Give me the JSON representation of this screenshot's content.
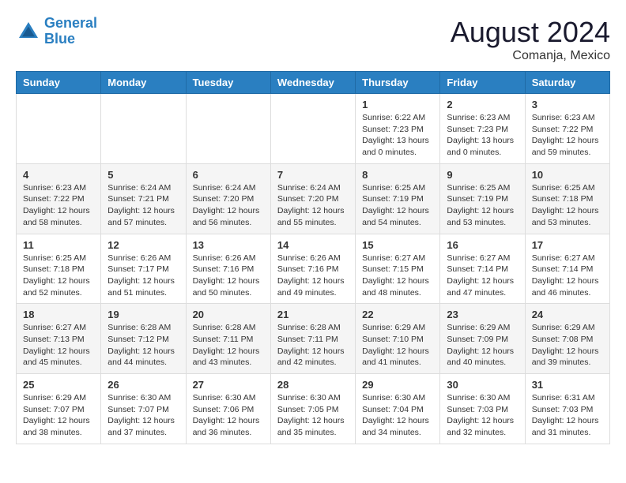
{
  "logo": {
    "line1": "General",
    "line2": "Blue"
  },
  "title": "August 2024",
  "location": "Comanja, Mexico",
  "days_of_week": [
    "Sunday",
    "Monday",
    "Tuesday",
    "Wednesday",
    "Thursday",
    "Friday",
    "Saturday"
  ],
  "weeks": [
    [
      {
        "day": "",
        "sunrise": "",
        "sunset": "",
        "daylight": ""
      },
      {
        "day": "",
        "sunrise": "",
        "sunset": "",
        "daylight": ""
      },
      {
        "day": "",
        "sunrise": "",
        "sunset": "",
        "daylight": ""
      },
      {
        "day": "",
        "sunrise": "",
        "sunset": "",
        "daylight": ""
      },
      {
        "day": "1",
        "sunrise": "Sunrise: 6:22 AM",
        "sunset": "Sunset: 7:23 PM",
        "daylight": "Daylight: 13 hours and 0 minutes."
      },
      {
        "day": "2",
        "sunrise": "Sunrise: 6:23 AM",
        "sunset": "Sunset: 7:23 PM",
        "daylight": "Daylight: 13 hours and 0 minutes."
      },
      {
        "day": "3",
        "sunrise": "Sunrise: 6:23 AM",
        "sunset": "Sunset: 7:22 PM",
        "daylight": "Daylight: 12 hours and 59 minutes."
      }
    ],
    [
      {
        "day": "4",
        "sunrise": "Sunrise: 6:23 AM",
        "sunset": "Sunset: 7:22 PM",
        "daylight": "Daylight: 12 hours and 58 minutes."
      },
      {
        "day": "5",
        "sunrise": "Sunrise: 6:24 AM",
        "sunset": "Sunset: 7:21 PM",
        "daylight": "Daylight: 12 hours and 57 minutes."
      },
      {
        "day": "6",
        "sunrise": "Sunrise: 6:24 AM",
        "sunset": "Sunset: 7:20 PM",
        "daylight": "Daylight: 12 hours and 56 minutes."
      },
      {
        "day": "7",
        "sunrise": "Sunrise: 6:24 AM",
        "sunset": "Sunset: 7:20 PM",
        "daylight": "Daylight: 12 hours and 55 minutes."
      },
      {
        "day": "8",
        "sunrise": "Sunrise: 6:25 AM",
        "sunset": "Sunset: 7:19 PM",
        "daylight": "Daylight: 12 hours and 54 minutes."
      },
      {
        "day": "9",
        "sunrise": "Sunrise: 6:25 AM",
        "sunset": "Sunset: 7:19 PM",
        "daylight": "Daylight: 12 hours and 53 minutes."
      },
      {
        "day": "10",
        "sunrise": "Sunrise: 6:25 AM",
        "sunset": "Sunset: 7:18 PM",
        "daylight": "Daylight: 12 hours and 53 minutes."
      }
    ],
    [
      {
        "day": "11",
        "sunrise": "Sunrise: 6:25 AM",
        "sunset": "Sunset: 7:18 PM",
        "daylight": "Daylight: 12 hours and 52 minutes."
      },
      {
        "day": "12",
        "sunrise": "Sunrise: 6:26 AM",
        "sunset": "Sunset: 7:17 PM",
        "daylight": "Daylight: 12 hours and 51 minutes."
      },
      {
        "day": "13",
        "sunrise": "Sunrise: 6:26 AM",
        "sunset": "Sunset: 7:16 PM",
        "daylight": "Daylight: 12 hours and 50 minutes."
      },
      {
        "day": "14",
        "sunrise": "Sunrise: 6:26 AM",
        "sunset": "Sunset: 7:16 PM",
        "daylight": "Daylight: 12 hours and 49 minutes."
      },
      {
        "day": "15",
        "sunrise": "Sunrise: 6:27 AM",
        "sunset": "Sunset: 7:15 PM",
        "daylight": "Daylight: 12 hours and 48 minutes."
      },
      {
        "day": "16",
        "sunrise": "Sunrise: 6:27 AM",
        "sunset": "Sunset: 7:14 PM",
        "daylight": "Daylight: 12 hours and 47 minutes."
      },
      {
        "day": "17",
        "sunrise": "Sunrise: 6:27 AM",
        "sunset": "Sunset: 7:14 PM",
        "daylight": "Daylight: 12 hours and 46 minutes."
      }
    ],
    [
      {
        "day": "18",
        "sunrise": "Sunrise: 6:27 AM",
        "sunset": "Sunset: 7:13 PM",
        "daylight": "Daylight: 12 hours and 45 minutes."
      },
      {
        "day": "19",
        "sunrise": "Sunrise: 6:28 AM",
        "sunset": "Sunset: 7:12 PM",
        "daylight": "Daylight: 12 hours and 44 minutes."
      },
      {
        "day": "20",
        "sunrise": "Sunrise: 6:28 AM",
        "sunset": "Sunset: 7:11 PM",
        "daylight": "Daylight: 12 hours and 43 minutes."
      },
      {
        "day": "21",
        "sunrise": "Sunrise: 6:28 AM",
        "sunset": "Sunset: 7:11 PM",
        "daylight": "Daylight: 12 hours and 42 minutes."
      },
      {
        "day": "22",
        "sunrise": "Sunrise: 6:29 AM",
        "sunset": "Sunset: 7:10 PM",
        "daylight": "Daylight: 12 hours and 41 minutes."
      },
      {
        "day": "23",
        "sunrise": "Sunrise: 6:29 AM",
        "sunset": "Sunset: 7:09 PM",
        "daylight": "Daylight: 12 hours and 40 minutes."
      },
      {
        "day": "24",
        "sunrise": "Sunrise: 6:29 AM",
        "sunset": "Sunset: 7:08 PM",
        "daylight": "Daylight: 12 hours and 39 minutes."
      }
    ],
    [
      {
        "day": "25",
        "sunrise": "Sunrise: 6:29 AM",
        "sunset": "Sunset: 7:07 PM",
        "daylight": "Daylight: 12 hours and 38 minutes."
      },
      {
        "day": "26",
        "sunrise": "Sunrise: 6:30 AM",
        "sunset": "Sunset: 7:07 PM",
        "daylight": "Daylight: 12 hours and 37 minutes."
      },
      {
        "day": "27",
        "sunrise": "Sunrise: 6:30 AM",
        "sunset": "Sunset: 7:06 PM",
        "daylight": "Daylight: 12 hours and 36 minutes."
      },
      {
        "day": "28",
        "sunrise": "Sunrise: 6:30 AM",
        "sunset": "Sunset: 7:05 PM",
        "daylight": "Daylight: 12 hours and 35 minutes."
      },
      {
        "day": "29",
        "sunrise": "Sunrise: 6:30 AM",
        "sunset": "Sunset: 7:04 PM",
        "daylight": "Daylight: 12 hours and 34 minutes."
      },
      {
        "day": "30",
        "sunrise": "Sunrise: 6:30 AM",
        "sunset": "Sunset: 7:03 PM",
        "daylight": "Daylight: 12 hours and 32 minutes."
      },
      {
        "day": "31",
        "sunrise": "Sunrise: 6:31 AM",
        "sunset": "Sunset: 7:03 PM",
        "daylight": "Daylight: 12 hours and 31 minutes."
      }
    ]
  ]
}
